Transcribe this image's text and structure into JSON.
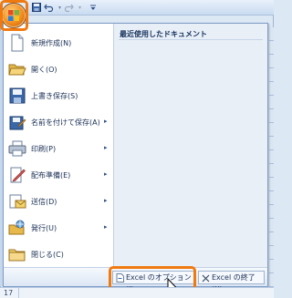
{
  "qat": {
    "save_icon": "save-icon",
    "undo_icon": "undo-icon",
    "redo_icon": "redo-icon",
    "customize_icon": "dropdown-arrow-icon"
  },
  "menu": {
    "recent_title": "最近使用したドキュメント",
    "items": [
      {
        "label": "新規作成(N)",
        "icon": "new-document-icon",
        "has_submenu": false
      },
      {
        "label": "開く(O)",
        "icon": "open-folder-icon",
        "has_submenu": false
      },
      {
        "label": "上書き保存(S)",
        "icon": "save-disk-icon",
        "has_submenu": false
      },
      {
        "label": "名前を付けて保存(A)",
        "icon": "save-as-icon",
        "has_submenu": true
      },
      {
        "label": "印刷(P)",
        "icon": "printer-icon",
        "has_submenu": true
      },
      {
        "label": "配布準備(E)",
        "icon": "prepare-icon",
        "has_submenu": true
      },
      {
        "label": "送信(D)",
        "icon": "send-mail-icon",
        "has_submenu": true
      },
      {
        "label": "発行(U)",
        "icon": "publish-icon",
        "has_submenu": true
      },
      {
        "label": "閉じる(C)",
        "icon": "close-folder-icon",
        "has_submenu": false
      }
    ],
    "arrow_glyph": "▸",
    "footer": {
      "options_label": "Excel のオプション(I)",
      "exit_label": "Excel の終了(X)"
    }
  },
  "status": {
    "row_number": "17"
  },
  "colors": {
    "highlight": "#f07a10",
    "office_orange": "#f08a1c",
    "menu_right_bg": "#e9eff7"
  }
}
